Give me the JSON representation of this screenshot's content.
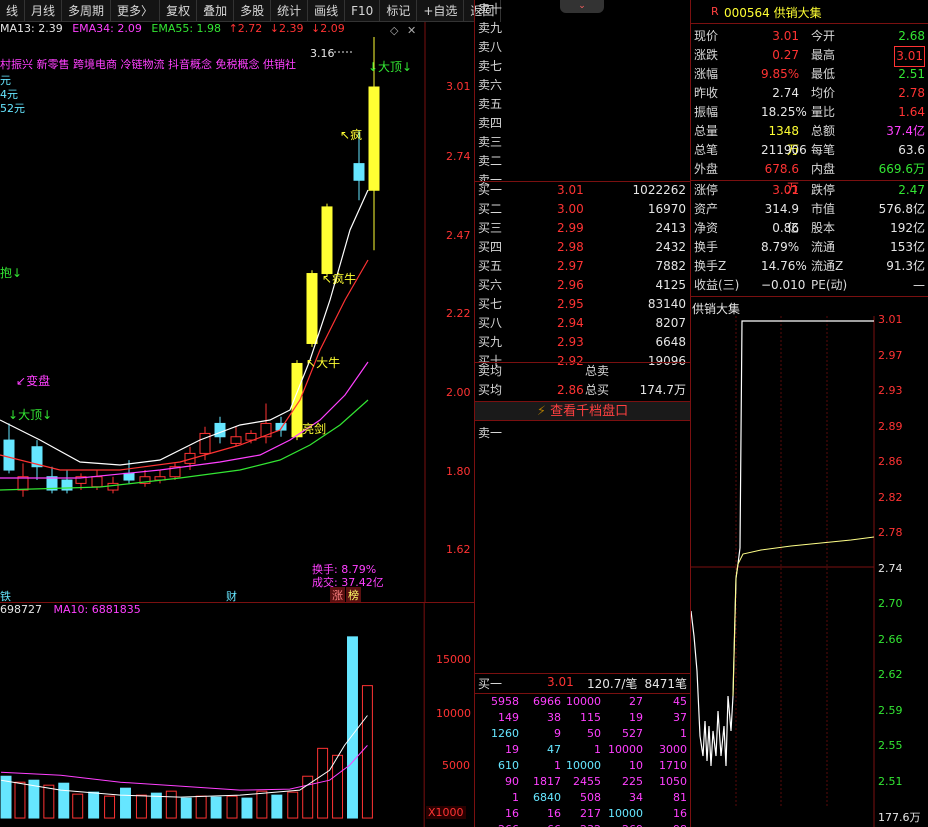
{
  "toolbar": {
    "items": [
      "线",
      "月线",
      "多周期",
      "更多〉",
      "复权",
      "叠加",
      "多股",
      "统计",
      "画线",
      "F10",
      "标记",
      "+自选",
      "返回"
    ]
  },
  "ema_line": {
    "ema13": "MA13: 2.39",
    "ema34": "EMA34: 2.09",
    "ema55": "EMA55: 1.98",
    "extra1": "↑2.72",
    "extra2": "↓2.39",
    "extra3": "↓2.09"
  },
  "concepts": "村振兴 新零售 跨境电商 冷链物流 抖音概念 免税概念 供销社",
  "left_side_labels": [
    "元",
    "4元",
    "52元"
  ],
  "main_chart": {
    "price_labels": [
      "3.01",
      "2.74",
      "2.47",
      "2.22",
      "2.00",
      "1.80",
      "1.62"
    ],
    "peak_label": "3.16",
    "annotations": {
      "big_top_1": "↓大顶↓",
      "crazy": "疯",
      "crazy_bull": "疯牛",
      "big_bull": "大牛",
      "sword": "亮剑",
      "bian_pan": "变盘",
      "big_top_2": "大顶↓",
      "left_arrow": "抱↓"
    },
    "turnover": "换手: 8.79%",
    "amount": "成交: 37.42亿",
    "bottom_marks": {
      "left": "铁",
      "cai": "财",
      "zhang": "涨",
      "bang": "榜"
    }
  },
  "volume_chart": {
    "header_a": "698727",
    "header_b": "MA10: 6881835",
    "axis_labels": [
      "15000",
      "10000",
      "5000"
    ],
    "unit": "X1000",
    "bars": [
      4200,
      3600,
      3800,
      3300,
      3500,
      2400,
      2600,
      2200,
      3000,
      2300,
      2500,
      2700,
      2000,
      2200,
      2100,
      2200,
      2000,
      2700,
      2300,
      2600,
      2500,
      2800,
      2400,
      2600,
      2900,
      2400,
      2700,
      2600,
      3100,
      2900,
      7000,
      3300,
      6300,
      18200,
      7100
    ]
  },
  "order_book": {
    "sell_labels": [
      "卖十",
      "卖九",
      "卖八",
      "卖七",
      "卖六",
      "卖五",
      "卖四",
      "卖三",
      "卖二",
      "卖一"
    ],
    "buy": [
      {
        "label": "买一",
        "price": "3.01",
        "volume": "1022262"
      },
      {
        "label": "买二",
        "price": "3.00",
        "volume": "16970"
      },
      {
        "label": "买三",
        "price": "2.99",
        "volume": "2413"
      },
      {
        "label": "买四",
        "price": "2.98",
        "volume": "2432"
      },
      {
        "label": "买五",
        "price": "2.97",
        "volume": "7882"
      },
      {
        "label": "买六",
        "price": "2.96",
        "volume": "4125"
      },
      {
        "label": "买七",
        "price": "2.95",
        "volume": "83140"
      },
      {
        "label": "买八",
        "price": "2.94",
        "volume": "8207"
      },
      {
        "label": "买九",
        "price": "2.93",
        "volume": "6648"
      },
      {
        "label": "买十",
        "price": "2.92",
        "volume": "19096"
      }
    ],
    "sell_avg_label": "卖均",
    "total_sell_label": "总卖",
    "buy_avg_label": "买均",
    "buy_avg": "2.86",
    "total_buy_label": "总买",
    "total_buy": "174.7万",
    "thousand_btn": "查看千档盘口",
    "sell_one_label": "卖一",
    "buy_one": {
      "label": "买一",
      "price": "3.01",
      "per": "120.7/笔",
      "count": "8471笔"
    }
  },
  "tape": [
    [
      "5958",
      "6966",
      "10000",
      "27",
      "45"
    ],
    [
      "149",
      "38",
      "115",
      "19",
      "37"
    ],
    [
      "1260",
      "9",
      "50",
      "527",
      "1"
    ],
    [
      "19",
      "47",
      "1",
      "10000",
      "3000"
    ],
    [
      "610",
      "1",
      "10000",
      "10",
      "1710"
    ],
    [
      "90",
      "1817",
      "2455",
      "225",
      "1050"
    ],
    [
      "1",
      "6840",
      "508",
      "34",
      "81"
    ],
    [
      "16",
      "16",
      "217",
      "10000",
      "16"
    ],
    [
      "266",
      "66",
      "232",
      "269",
      "98"
    ]
  ],
  "quote": {
    "r_mark": "R",
    "code_name": "000564 供销大集",
    "rows": [
      {
        "l1": "现价",
        "v1": "3.01",
        "c1": "#ff3333",
        "l2": "今开",
        "v2": "2.68",
        "c2": "#33e633"
      },
      {
        "l1": "涨跌",
        "v1": "0.27",
        "c1": "#ff3333",
        "l2": "最高",
        "v2": "3.01",
        "c2": "#ff3333"
      },
      {
        "l1": "涨幅",
        "v1": "9.85%",
        "c1": "#ff3333",
        "l2": "最低",
        "v2": "2.51",
        "c2": "#33e633"
      },
      {
        "l1": "昨收",
        "v1": "2.74",
        "c1": "#e6e6e6",
        "l2": "均价",
        "v2": "2.78",
        "c2": "#ff3333"
      },
      {
        "l1": "振幅",
        "v1": "18.25%",
        "c1": "#e6e6e6",
        "l2": "量比",
        "v2": "1.64",
        "c2": "#ff3333"
      },
      {
        "l1": "总量",
        "v1": "1348万",
        "c1": "#ffff33",
        "l2": "总额",
        "v2": "37.4亿",
        "c2": "#ff40ff"
      },
      {
        "l1": "总笔",
        "v1": "211906",
        "c1": "#e6e6e6",
        "l2": "每笔",
        "v2": "63.6",
        "c2": "#e6e6e6"
      },
      {
        "l1": "外盘",
        "v1": "678.6万",
        "c1": "#ff3333",
        "l2": "内盘",
        "v2": "669.6万",
        "c2": "#33e633"
      }
    ],
    "rows2": [
      {
        "l1": "涨停",
        "v1": "3.01",
        "c1": "#ff3333",
        "l2": "跌停",
        "v2": "2.47",
        "c2": "#33e633"
      },
      {
        "l1": "资产",
        "v1": "314.9亿",
        "c1": "#e6e6e6",
        "l2": "市值",
        "v2": "576.8亿",
        "c2": "#e6e6e6"
      },
      {
        "l1": "净资",
        "v1": "0.86",
        "c1": "#e6e6e6",
        "l2": "股本",
        "v2": "192亿",
        "c2": "#e6e6e6"
      },
      {
        "l1": "换手",
        "v1": "8.79%",
        "c1": "#e6e6e6",
        "l2": "流通",
        "v2": "153亿",
        "c2": "#e6e6e6"
      },
      {
        "l1": "换手Z",
        "v1": "14.76%",
        "c1": "#e6e6e6",
        "l2": "流通Z",
        "v2": "91.3亿",
        "c2": "#e6e6e6"
      },
      {
        "l1": "收益(三)",
        "v1": "−0.010",
        "c1": "#e6e6e6",
        "l2": "PE(动)",
        "v2": "—",
        "c2": "#e6e6e6"
      }
    ]
  },
  "intraday": {
    "title": "供销大集",
    "price_labels": [
      "3.01",
      "2.97",
      "2.93",
      "2.89",
      "2.86",
      "2.82",
      "2.78",
      "2.74",
      "2.70",
      "2.66",
      "2.62",
      "2.59",
      "2.55",
      "2.51"
    ],
    "vol_label": "177.6万"
  },
  "colors": {
    "up": "#ff3333",
    "down": "#33e633",
    "frame": "#7a1010"
  }
}
